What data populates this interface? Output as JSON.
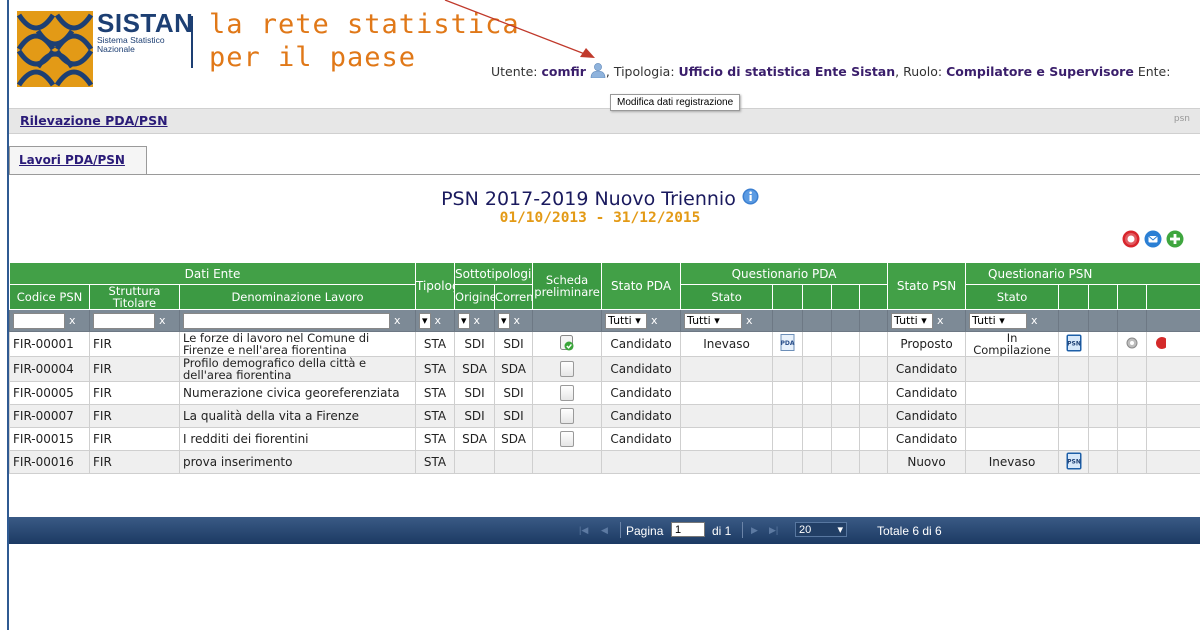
{
  "header": {
    "logo_title": "SISTAN",
    "logo_sub1": "Sistema Statistico",
    "logo_sub2": "Nazionale",
    "tagline1": "la rete statistica",
    "tagline2": "per il paese",
    "user_label": "Utente:",
    "user_value": "comfir",
    "tipologia_label": ", Tipologia:",
    "tipologia_value": "Ufficio di statistica Ente Sistan",
    "ruolo_label": ", Ruolo:",
    "ruolo_value": "Compilatore e Supervisore",
    "ente_label": "Ente:",
    "tooltip": "Modifica dati registrazione"
  },
  "breadcrumb": {
    "label": "Rilevazione PDA/PSN",
    "right": "psn"
  },
  "tabs": [
    {
      "label": "Lavori PDA/PSN"
    }
  ],
  "page": {
    "title": "PSN 2017-2019 Nuovo Triennio",
    "dates": "01/10/2013 - 31/12/2015"
  },
  "actions": [
    {
      "icon": "delete-icon",
      "color": "#d8252c"
    },
    {
      "icon": "mail-icon",
      "color": "#2b7fd4"
    },
    {
      "icon": "add-icon",
      "color": "#3fa63f"
    }
  ],
  "grid": {
    "group_headers": {
      "dati_ente": "Dati Ente",
      "sottotipologia": "Sottotipologia",
      "scheda": "Scheda preliminare",
      "stato_pda": "Stato PDA",
      "questionario_pda": "Questionario PDA",
      "stato_psn": "Stato PSN",
      "questionario_psn": "Questionario PSN"
    },
    "columns": {
      "codice": "Codice PSN",
      "struttura": "Struttura Titolare",
      "denominazione": "Denominazione Lavoro",
      "tipologia": "Tipologia",
      "origine": "Origine",
      "corrente": "Corrente",
      "stato": "Stato"
    },
    "filters": {
      "tutti": "Tutti",
      "clear": "x"
    },
    "rows": [
      {
        "codice": "FIR-00001",
        "struttura": "FIR",
        "denominazione": "Le forze di lavoro nel Comune di Firenze e nell'area fiorentina",
        "tipologia": "STA",
        "origine": "SDI",
        "corrente": "SDI",
        "scheda": "checked",
        "stato_pda": "Candidato",
        "q_pda_stato": "Inevaso",
        "pda_icon": true,
        "stato_psn": "Proposto",
        "q_psn_stato": "In Compilazione",
        "psn_icon": true,
        "extra_icons": true
      },
      {
        "codice": "FIR-00004",
        "struttura": "FIR",
        "denominazione": "Profilo demografico della città e dell'area fiorentina",
        "tipologia": "STA",
        "origine": "SDA",
        "corrente": "SDA",
        "scheda": "empty",
        "stato_pda": "Candidato",
        "q_pda_stato": "",
        "pda_icon": false,
        "stato_psn": "Candidato",
        "q_psn_stato": "",
        "psn_icon": false,
        "extra_icons": false
      },
      {
        "codice": "FIR-00005",
        "struttura": "FIR",
        "denominazione": "Numerazione civica georeferenziata",
        "tipologia": "STA",
        "origine": "SDI",
        "corrente": "SDI",
        "scheda": "empty",
        "stato_pda": "Candidato",
        "q_pda_stato": "",
        "pda_icon": false,
        "stato_psn": "Candidato",
        "q_psn_stato": "",
        "psn_icon": false,
        "extra_icons": false
      },
      {
        "codice": "FIR-00007",
        "struttura": "FIR",
        "denominazione": "La qualità della vita a Firenze",
        "tipologia": "STA",
        "origine": "SDI",
        "corrente": "SDI",
        "scheda": "empty",
        "stato_pda": "Candidato",
        "q_pda_stato": "",
        "pda_icon": false,
        "stato_psn": "Candidato",
        "q_psn_stato": "",
        "psn_icon": false,
        "extra_icons": false
      },
      {
        "codice": "FIR-00015",
        "struttura": "FIR",
        "denominazione": "I redditi dei fiorentini",
        "tipologia": "STA",
        "origine": "SDA",
        "corrente": "SDA",
        "scheda": "empty",
        "stato_pda": "Candidato",
        "q_pda_stato": "",
        "pda_icon": false,
        "stato_psn": "Candidato",
        "q_psn_stato": "",
        "psn_icon": false,
        "extra_icons": false
      },
      {
        "codice": "FIR-00016",
        "struttura": "FIR",
        "denominazione": "prova inserimento",
        "tipologia": "STA",
        "origine": "",
        "corrente": "",
        "scheda": "none",
        "stato_pda": "",
        "q_pda_stato": "",
        "pda_icon": false,
        "stato_psn": "Nuovo",
        "q_psn_stato": "Inevaso",
        "psn_icon": true,
        "extra_icons": false
      }
    ]
  },
  "pager": {
    "pagina_label": "Pagina",
    "page": "1",
    "di_label": "di 1",
    "page_size": "20",
    "totale": "Totale 6 di 6"
  }
}
